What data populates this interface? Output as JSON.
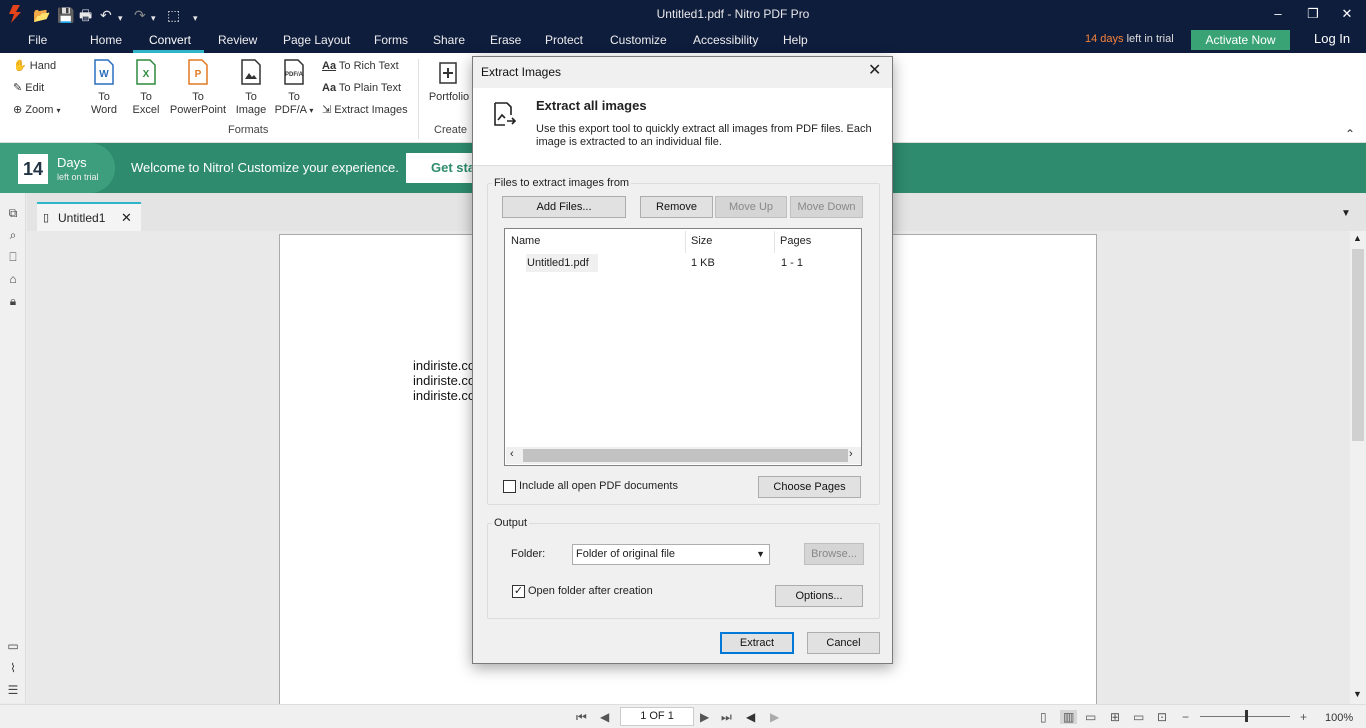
{
  "window": {
    "title": "Untitled1.pdf - Nitro PDF Pro",
    "min": "–",
    "max": "❐",
    "close": "✕"
  },
  "quick_access": {
    "open": "📂",
    "save": "💾",
    "print": "🖶",
    "undo": "↶",
    "redo": "↷",
    "select": "⬚",
    "more": "▾"
  },
  "menu": {
    "file": "File",
    "home": "Home",
    "convert": "Convert",
    "review": "Review",
    "page_layout": "Page Layout",
    "forms": "Forms",
    "share": "Share",
    "erase": "Erase",
    "protect": "Protect",
    "customize": "Customize",
    "accessibility": "Accessibility",
    "help": "Help"
  },
  "trial": {
    "days": "14 days",
    "rest": "left in trial",
    "activate": "Activate Now",
    "login": "Log In"
  },
  "ribbon": {
    "hand": "Hand",
    "edit": "Edit",
    "zoom": "Zoom",
    "to_word": [
      "To",
      "Word"
    ],
    "to_excel": [
      "To",
      "Excel"
    ],
    "to_powerpoint": [
      "To",
      "PowerPoint"
    ],
    "to_image": [
      "To",
      "Image"
    ],
    "to_pdfa": [
      "To",
      "PDF/A"
    ],
    "to_rich_text": "To Rich Text",
    "to_plain_text": "To Plain Text",
    "extract_images": "Extract Images",
    "formats_label": "Formats",
    "portfolio": "Portfolio",
    "create_label": "Create"
  },
  "banner": {
    "days_num": "14",
    "days": "Days",
    "days_sub": "left on trial",
    "welcome": "Welcome to Nitro! Customize your experience.",
    "get_started": "Get sta"
  },
  "tab": {
    "name": "Untitled1"
  },
  "document": {
    "lines": [
      "indiriste.co",
      "indiriste.co",
      "indiriste.co"
    ]
  },
  "status": {
    "page": "1 OF 1",
    "zoom": "100%"
  },
  "dialog": {
    "title": "Extract Images",
    "heading": "Extract all images",
    "description": "Use this export tool to quickly extract all images from PDF files. Each image is extracted to an individual file.",
    "files_group": "Files to extract images from",
    "add_files": "Add Files...",
    "remove": "Remove",
    "move_up": "Move Up",
    "move_down": "Move Down",
    "columns": {
      "name": "Name",
      "size": "Size",
      "pages": "Pages"
    },
    "files": [
      {
        "name": "Untitled1.pdf",
        "size": "1 KB",
        "pages": "1 - 1"
      }
    ],
    "include_all": "Include all open PDF documents",
    "include_all_checked": false,
    "choose_pages": "Choose Pages",
    "output_group": "Output",
    "folder_label": "Folder:",
    "folder_value": "Folder of original file",
    "browse": "Browse...",
    "open_folder": "Open folder after creation",
    "open_folder_checked": true,
    "options": "Options...",
    "extract": "Extract",
    "cancel": "Cancel"
  },
  "colors": {
    "titlebar": "#0f1d3d",
    "accent": "#2fb4c8",
    "activate": "#3aa376",
    "banner": "#2e8b6e",
    "trial_highlight": "#f4823a"
  }
}
